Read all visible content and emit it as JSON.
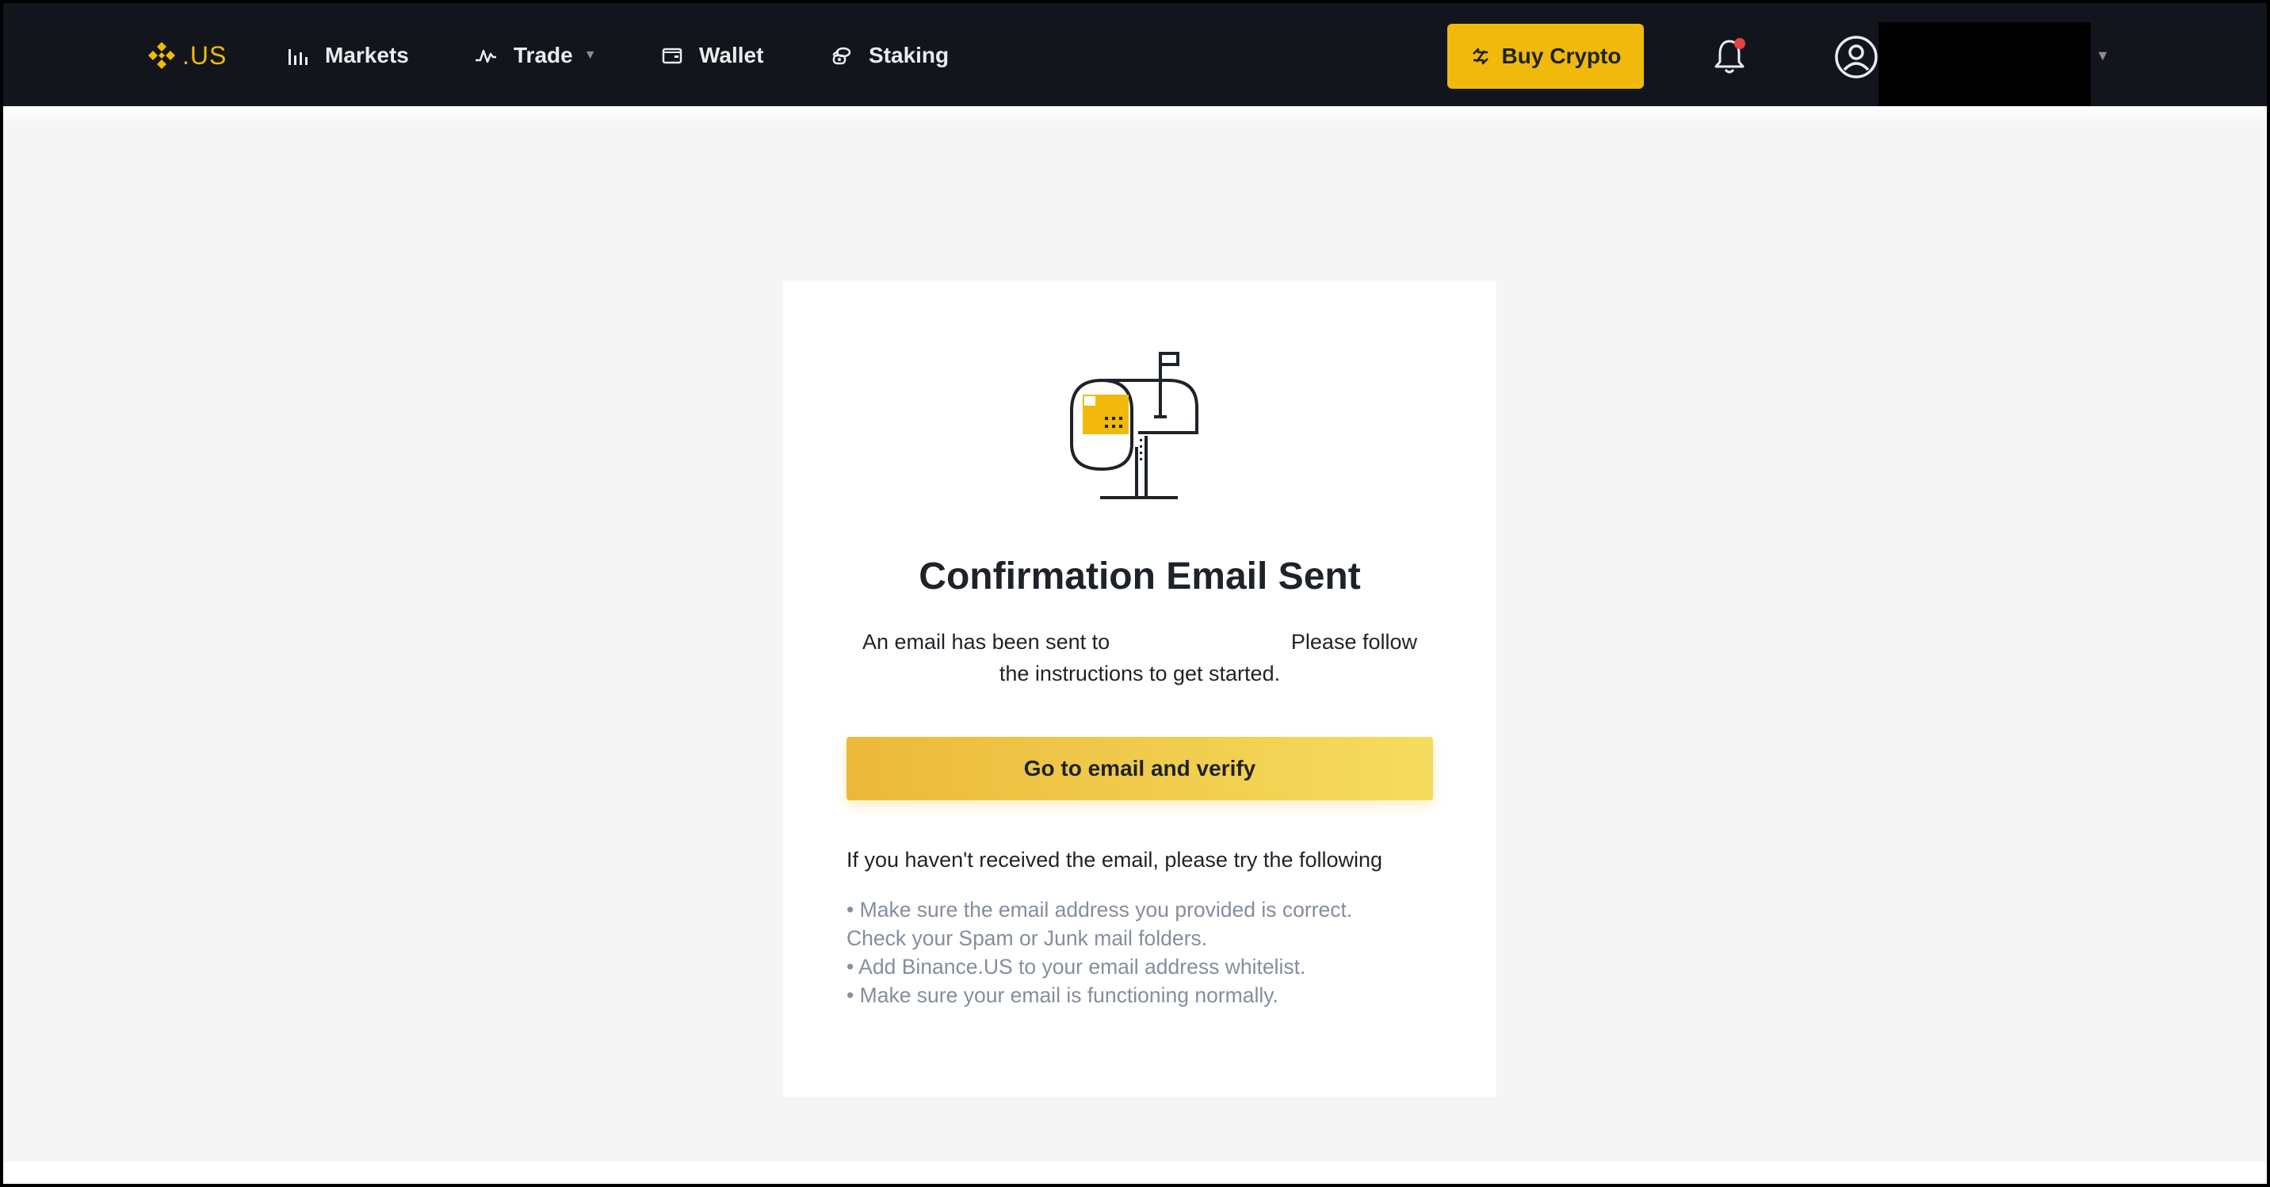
{
  "header": {
    "logo_text": ".US",
    "nav": [
      {
        "label": "Markets",
        "icon": "bar-chart-icon"
      },
      {
        "label": "Trade",
        "icon": "trade-pulse-icon",
        "has_dropdown": true
      },
      {
        "label": "Wallet",
        "icon": "wallet-icon"
      },
      {
        "label": "Staking",
        "icon": "staking-coins-icon"
      }
    ],
    "buy_button": {
      "label": "Buy Crypto",
      "icon": "exchange-arrows-icon"
    },
    "notification_icon": "bell-icon",
    "account_icon": "user-circle-icon"
  },
  "card": {
    "illustration": "mailbox-icon",
    "title": "Confirmation Email Sent",
    "message_part1": "An email has been sent to",
    "message_part2": "Please follow",
    "message_line2": "the instructions to get started.",
    "verify_button": "Go to email and verify",
    "help_heading": "If you haven't received the email, please try the following",
    "help_items": [
      "• Make sure the email address you provided is correct.",
      "Check your Spam or Junk mail folders.",
      "• Add Binance.US to your email address whitelist.",
      "• Make sure your email is functioning normally."
    ]
  },
  "colors": {
    "brand_yellow": "#f0b90b",
    "header_bg": "#12161c",
    "page_bg": "#f5f5f5",
    "text_primary": "#1e2329",
    "text_secondary": "#848e9c"
  }
}
